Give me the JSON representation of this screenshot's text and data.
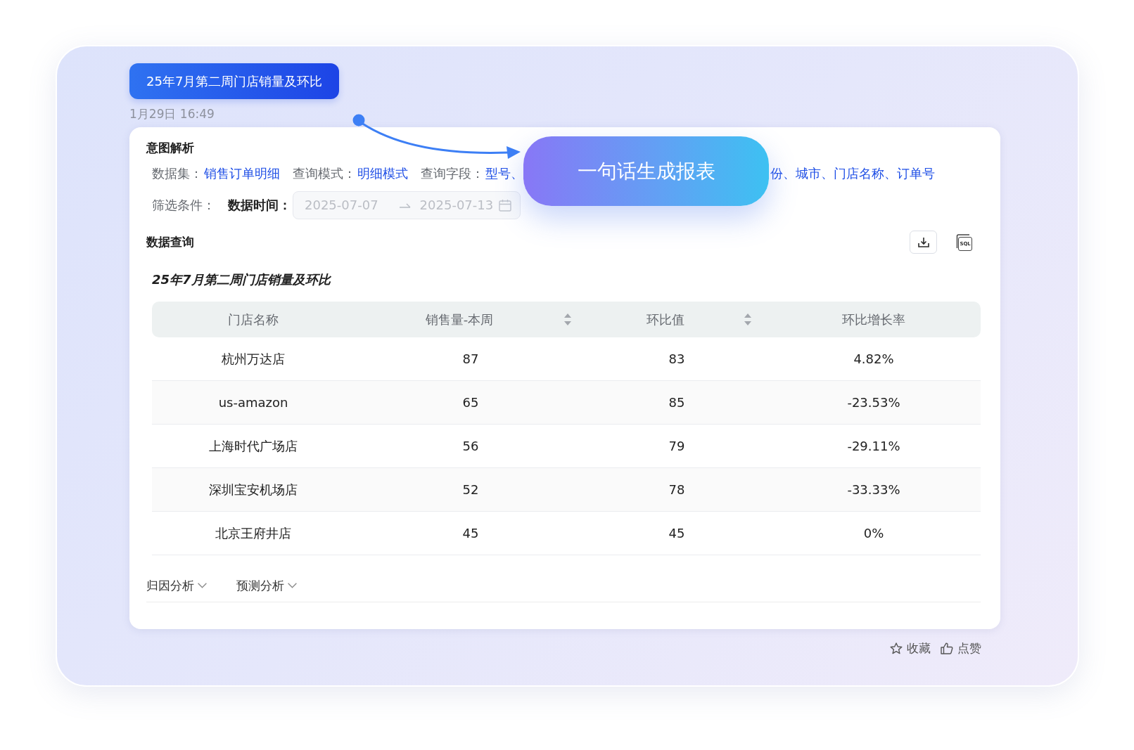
{
  "message": {
    "text": "25年7月第二周门店销量及环比",
    "timestamp": "1月29日 16:49"
  },
  "overlay_banner": {
    "text": "一句话生成报表"
  },
  "intent": {
    "title": "意图解析",
    "items": [
      {
        "label": "数据集：",
        "value_parts": [
          "销售订单明细"
        ]
      },
      {
        "label": "查询模式：",
        "value_parts": [
          "明细模式"
        ]
      },
      {
        "label": "查询字段：",
        "value_parts": [
          "型号、",
          "份、城市、门店名称、订单号"
        ]
      }
    ],
    "filter": {
      "label": "筛选条件：",
      "field_label": "数据时间：",
      "start": "2025-07-07",
      "end": "2025-07-13",
      "disabled": true
    }
  },
  "query": {
    "title": "数据查询",
    "sql_label": "SQL",
    "table": {
      "title": "25年7月第二周门店销量及环比",
      "columns": [
        {
          "label": "门店名称",
          "sortable": false
        },
        {
          "label": "销售量-本周",
          "sortable": true
        },
        {
          "label": "环比值",
          "sortable": true
        },
        {
          "label": "环比增长率",
          "sortable": false
        }
      ],
      "rows": [
        [
          "杭州万达店",
          "87",
          "83",
          "4.82%"
        ],
        [
          "us-amazon",
          "65",
          "85",
          "-23.53%"
        ],
        [
          "上海时代广场店",
          "56",
          "79",
          "-29.11%"
        ],
        [
          "深圳宝安机场店",
          "52",
          "78",
          "-33.33%"
        ],
        [
          "北京王府井店",
          "45",
          "45",
          "0%"
        ]
      ]
    }
  },
  "analysis_tabs": [
    {
      "label": "归因分析",
      "expanded": false
    },
    {
      "label": "预测分析",
      "expanded": false
    }
  ],
  "actions": [
    {
      "kind": "favorite",
      "label": "收藏"
    },
    {
      "kind": "like",
      "label": "点赞"
    }
  ]
}
